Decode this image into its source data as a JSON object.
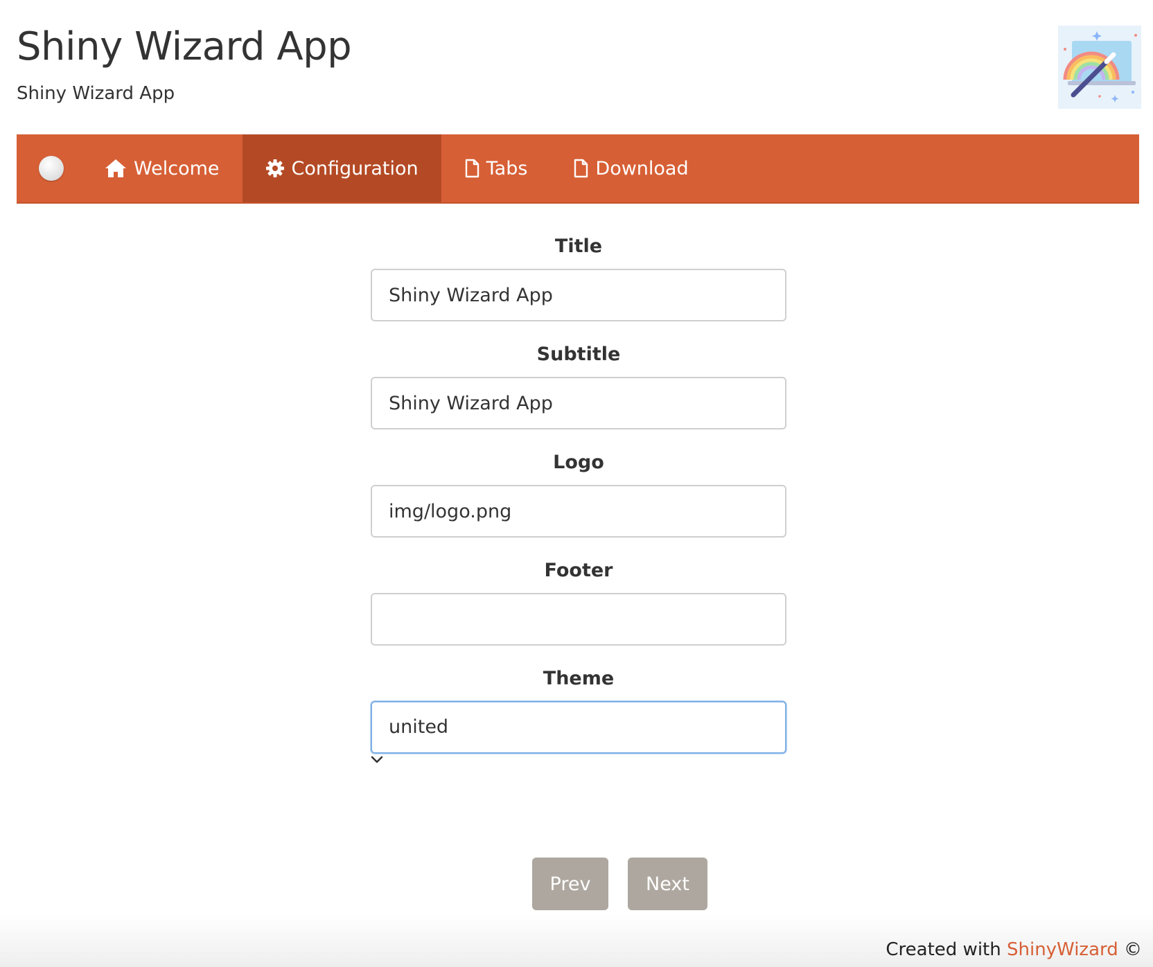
{
  "header": {
    "title": "Shiny Wizard App",
    "subtitle": "Shiny Wizard App"
  },
  "navbar": {
    "items": [
      {
        "label": "Welcome",
        "icon": "home-icon"
      },
      {
        "label": "Configuration",
        "icon": "gear-icon"
      },
      {
        "label": "Tabs",
        "icon": "file-icon"
      },
      {
        "label": "Download",
        "icon": "file-icon"
      }
    ],
    "active": "Configuration",
    "color": "#d75f35",
    "active_color": "#b44a25"
  },
  "form": {
    "title": {
      "label": "Title",
      "value": "Shiny Wizard App"
    },
    "subtitle": {
      "label": "Subtitle",
      "value": "Shiny Wizard App"
    },
    "logo": {
      "label": "Logo",
      "value": "img/logo.png"
    },
    "footer": {
      "label": "Footer",
      "value": ""
    },
    "theme": {
      "label": "Theme",
      "value": "united"
    }
  },
  "buttons": {
    "prev": "Prev",
    "next": "Next",
    "color": "#aea79f"
  },
  "footer": {
    "prefix": "Created with ",
    "link": "ShinyWizard",
    "suffix": " ©"
  }
}
